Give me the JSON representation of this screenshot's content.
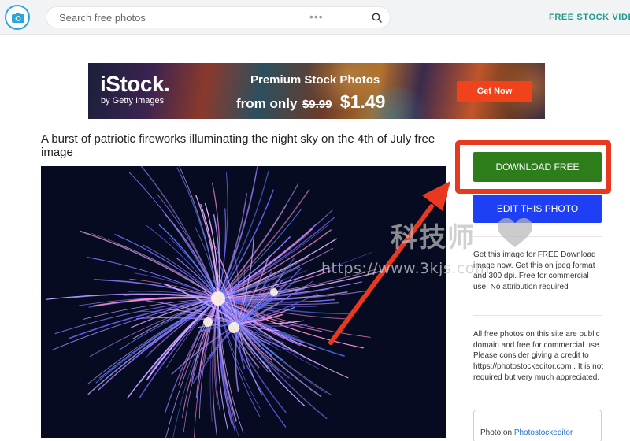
{
  "header": {
    "search": {
      "placeholder": "Search free photos",
      "value": ""
    },
    "more_dots": "•••",
    "nav_link": "FREE STOCK VIDEO"
  },
  "ad": {
    "brand": "iStock.",
    "brand_sub": "by Getty Images",
    "title": "Premium Stock Photos",
    "price_prefix": "from only",
    "old_price": "$9.99",
    "new_price": "$1.49",
    "cta": "Get Now"
  },
  "main": {
    "title": "A burst of patriotic fireworks illuminating the night sky on the 4th of July free image"
  },
  "sidebar": {
    "download_label": "DOWNLOAD FREE",
    "edit_label": "EDIT THIS PHOTO",
    "info_text": "Get this image for FREE Download image now. Get this on jpeg format and 300 dpi. Free for commercial use, No attribution required",
    "license_text": "All free photos on this site are public domain and free for commercial use. Please consider giving a credit to https://photostockeditor.com . It is not required but very much appreciated.",
    "credit_prefix": "Photo on",
    "credit_link": "Photostockeditor"
  },
  "watermark": {
    "chinese": "科技师",
    "url": "https://www.3kjs.com"
  },
  "colors": {
    "download_green": "#2e7d1b",
    "edit_blue": "#1f3ff5",
    "highlight_red": "#e8381f",
    "nav_teal": "#1e9c8e",
    "ad_cta": "#f0421b"
  }
}
